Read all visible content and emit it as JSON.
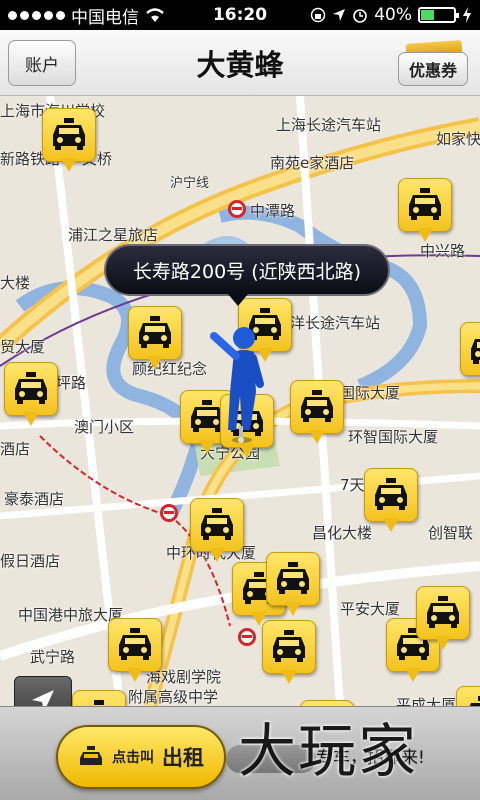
{
  "status_bar": {
    "carrier": "中国电信",
    "time": "16:20",
    "battery": "40%",
    "battery_level": 0.4,
    "icons": [
      "signal-dots",
      "wifi-icon",
      "lock-rotation-icon",
      "location-arrow-icon",
      "alarm-icon",
      "battery-icon",
      "charging-icon"
    ]
  },
  "nav": {
    "account_label": "账户",
    "title": "大黄蜂",
    "coupon_label": "优惠券"
  },
  "map": {
    "callout": "长寿路200号 (近陕西北路)",
    "labels": [
      "上海市海川学校",
      "上海长途汽车站",
      "如家快",
      "新路铁路",
      "文桥",
      "南苑e家酒店",
      "沪宁线",
      "中潭路",
      "浦江之星旅店",
      "中兴路",
      "大楼",
      "洋长途汽车站",
      "贸大厦",
      "坪路",
      "顾纪红纪念",
      "国际大厦",
      "澳门小区",
      "环智国际大厦",
      "酒店",
      "大宁公园",
      "7天",
      "豪泰酒店",
      "昌化大楼",
      "创智联",
      "假日酒店",
      "中环时代大厦",
      "中国港中旅大厦",
      "平安大厦",
      "武宁路",
      "海戏剧学院",
      "附属高级中学",
      "平成大厦"
    ],
    "metro_icon": "metro-icon",
    "taxi_icon": "taxi-icon"
  },
  "bottom": {
    "call_small": "点击叫",
    "call_big": "出租",
    "special_car": "专车，招即来!",
    "watermark": "大玩家"
  },
  "colors": {
    "accent_yellow": "#f3c21d",
    "road_yellow": "#f5c24a",
    "water": "#8fb4e0",
    "metro_red": "#d8232a"
  }
}
